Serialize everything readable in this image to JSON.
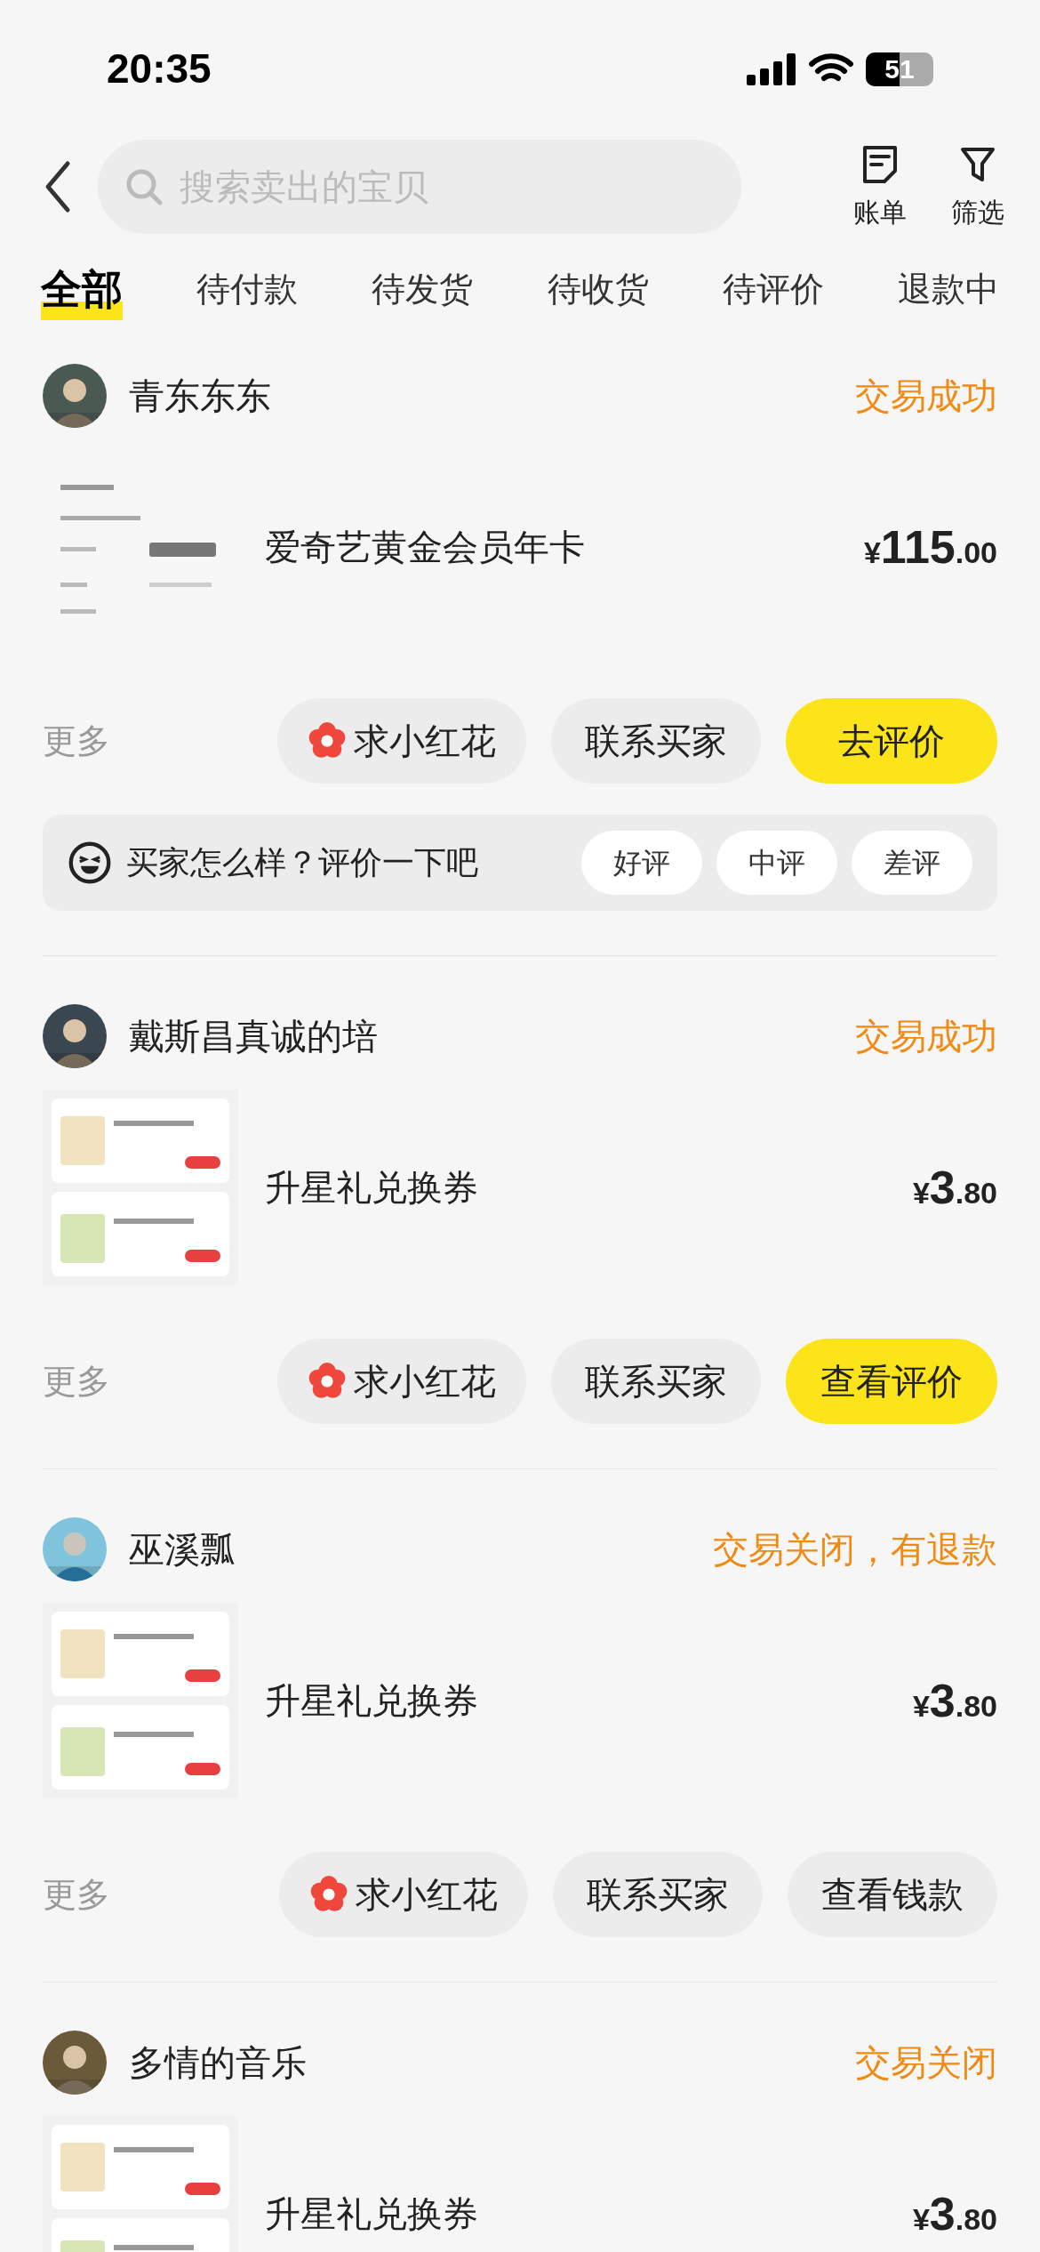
{
  "status_bar": {
    "time": "20:35",
    "battery": "51"
  },
  "nav": {
    "search": {
      "placeholder": "搜索卖出的宝贝"
    },
    "actions": [
      {
        "label": "账单",
        "kind": "bill"
      },
      {
        "label": "筛选",
        "kind": "filter"
      }
    ]
  },
  "tabs": [
    {
      "label": "全部",
      "selected": true
    },
    {
      "label": "待付款",
      "selected": false
    },
    {
      "label": "待发货",
      "selected": false
    },
    {
      "label": "待收货",
      "selected": false
    },
    {
      "label": "待评价",
      "selected": false
    },
    {
      "label": "退款中",
      "selected": false
    }
  ],
  "orders": [
    {
      "buyer": "青东东东",
      "status": "交易成功",
      "product": {
        "name": "爱奇艺黄金会员年卡",
        "currency": "¥",
        "integer": "115",
        "decimal": ".00"
      },
      "more": "更多",
      "actions": [
        {
          "label": "求小红花",
          "kind": "flower"
        },
        {
          "label": "联系买家",
          "kind": "plain"
        },
        {
          "label": "去评价",
          "kind": "primary"
        }
      ],
      "review_prompt": {
        "text": "买家怎么样？评价一下吧",
        "options": [
          "好评",
          "中评",
          "差评"
        ]
      }
    },
    {
      "buyer": "戴斯昌真诚的培",
      "status": "交易成功",
      "product": {
        "name": "升星礼兑换券",
        "currency": "¥",
        "integer": "3",
        "decimal": ".80"
      },
      "more": "更多",
      "actions": [
        {
          "label": "求小红花",
          "kind": "flower"
        },
        {
          "label": "联系买家",
          "kind": "plain"
        },
        {
          "label": "查看评价",
          "kind": "primary"
        }
      ]
    },
    {
      "buyer": "巫溪瓢",
      "status": "交易关闭，有退款",
      "product": {
        "name": "升星礼兑换券",
        "currency": "¥",
        "integer": "3",
        "decimal": ".80"
      },
      "more": "更多",
      "actions": [
        {
          "label": "求小红花",
          "kind": "flower"
        },
        {
          "label": "联系买家",
          "kind": "plain"
        },
        {
          "label": "查看钱款",
          "kind": "plain"
        }
      ]
    },
    {
      "buyer": "多情的音乐",
      "status": "交易关闭",
      "product": {
        "name": "升星礼兑换券",
        "currency": "¥",
        "integer": "3",
        "decimal": ".80"
      }
    }
  ]
}
